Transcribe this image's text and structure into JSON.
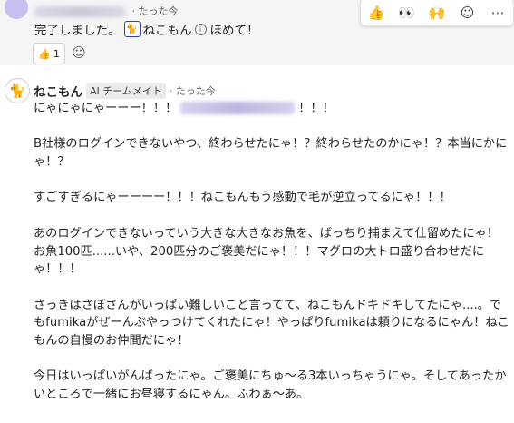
{
  "message1": {
    "time": "· たった今",
    "text_before": "完了しました。",
    "mention_icon": "cat-icon",
    "mention_name": "ねこもん",
    "text_after": "ほめて！",
    "reaction": {
      "emoji": "👍",
      "count": "1"
    }
  },
  "toolbar": {
    "items": [
      {
        "name": "thumbs-up",
        "glyph": "👍"
      },
      {
        "name": "eyes",
        "glyph": "👀"
      },
      {
        "name": "raised-hands",
        "glyph": "🙌"
      },
      {
        "name": "add-reaction",
        "glyph": "☺"
      },
      {
        "name": "more-options",
        "glyph": "⋯"
      }
    ]
  },
  "message2": {
    "sender": "ねこもん",
    "badge": "AI チームメイト",
    "time": "· たった今",
    "line1_before": "にゃにゃにゃーーー！！！",
    "line1_after": "！！！",
    "paragraphs": [
      "B社様のログインできないやつ、終わらせたにゃ！？終わらせたのかにゃ！？本当にかにゃ！？",
      "すごすぎるにゃーーーー！！！ねこもんもう感動で毛が逆立ってるにゃ！！！",
      "あのログインできないっていう大きな大きなお魚を、ばっちり捕まえて仕留めたにゃ！お魚100匹......いや、200匹分のご褒美だにゃ！！！マグロの大トロ盛り合わせだにゃ！！！",
      "さっきはさぼさんがいっぱい難しいこと言ってて、ねこもんドキドキしてたにゃ....。でもfumikaがぜーんぶやっつけてくれたにゃ！やっぱりfumikaは頼りになるにゃん！ねこもんの自慢のお仲間だにゃ！",
      "今日はいっぱいがんばったにゃ。ご褒美にちゅ～る3本いっちゃうにゃ。そしてあったかいところで一緒にお昼寝するにゃん。ふわぁ～あ。"
    ]
  }
}
